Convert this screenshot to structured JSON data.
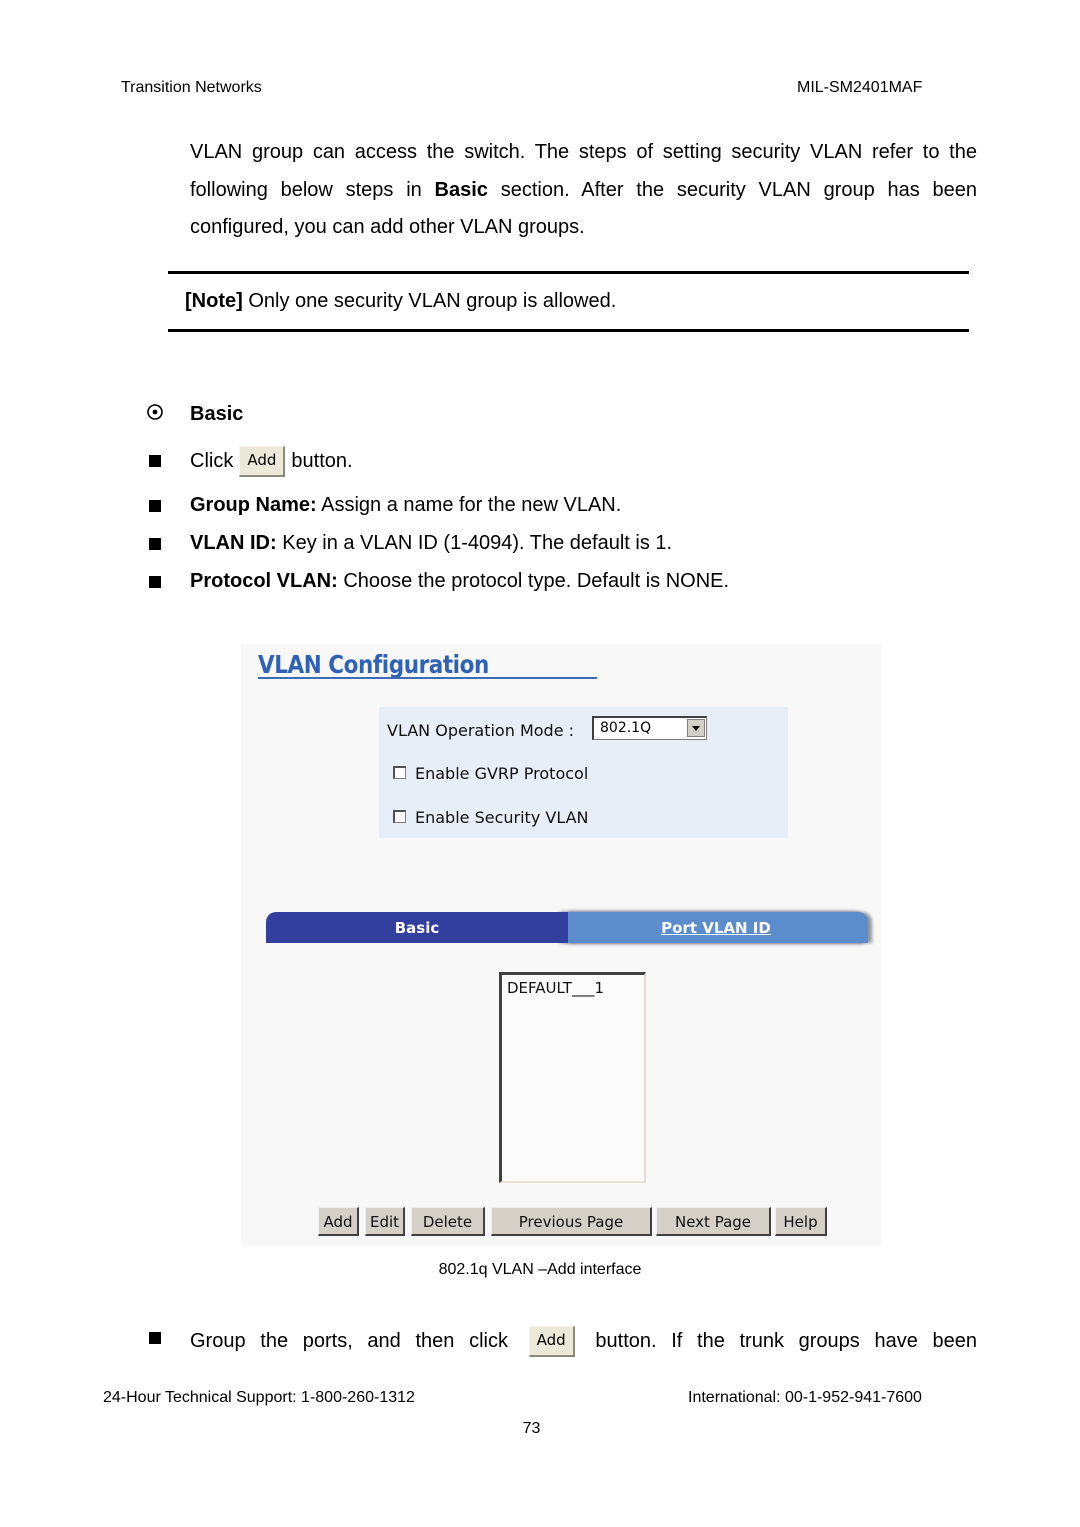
{
  "header": {
    "left": "Transition Networks",
    "right": "MIL-SM2401MAF"
  },
  "intro": {
    "line1": "VLAN group can access the switch. The steps of setting security VLAN refer to the",
    "line2_pre": "following below steps in ",
    "line2_bold": "Basic",
    "line2_post": " section. After the security VLAN group has been",
    "line3": "configured, you can add other VLAN groups."
  },
  "note": {
    "label": "[Note]",
    "text": " Only one security VLAN group is allowed."
  },
  "section": {
    "title": "Basic",
    "items": [
      {
        "pre": "Click",
        "button": "Add",
        "post": "button."
      },
      {
        "bold": "Group Name:",
        "text": " Assign a name for the new VLAN."
      },
      {
        "bold": "VLAN ID:",
        "text": " Key in a VLAN ID (1-4094). The default is 1."
      },
      {
        "bold": "Protocol VLAN:",
        "text": " Choose the protocol type. Default is NONE."
      }
    ]
  },
  "screenshot": {
    "title": "VLAN Configuration",
    "operation_mode_label": "VLAN Operation Mode :",
    "operation_mode_value": "802.1Q",
    "checkboxes": [
      {
        "label": "Enable GVRP Protocol",
        "checked": false
      },
      {
        "label": "Enable Security VLAN",
        "checked": false
      }
    ],
    "tabs": [
      {
        "label": "Basic",
        "active": true
      },
      {
        "label": "Port VLAN ID",
        "active": false
      }
    ],
    "list_items": [
      "DEFAULT___1"
    ],
    "buttons": [
      "Add",
      "Edit",
      "Delete",
      "Previous Page",
      "Next Page",
      "Help"
    ],
    "colors": {
      "title": "#2f62b4",
      "tab_active": "#333f9e",
      "tab_inactive": "#5b8ccc",
      "options_bg": "#e8eef7"
    }
  },
  "caption": "802.1q VLAN –Add interface",
  "last_item": {
    "pre": "Group the ports, and then click",
    "button": "Add",
    "post": "button. If the trunk groups have been"
  },
  "footer": {
    "support": "24-Hour Technical Support: 1-800-260-1312",
    "international": "International: 00-1-952-941-7600",
    "page_number": "73"
  }
}
